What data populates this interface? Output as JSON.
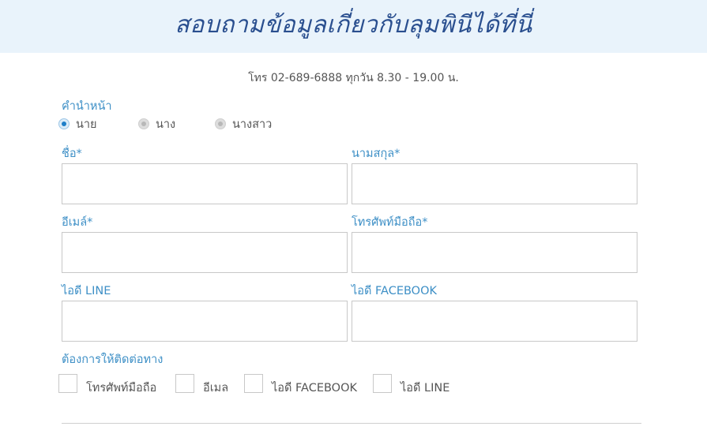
{
  "banner": {
    "title": "สอบถามข้อมูลเกี่ยวกับลุมพินีได้ที่นี่"
  },
  "contact": {
    "phone_line": "โทร 02-689-6888 ทุกวัน 8.30 - 19.00 น."
  },
  "form": {
    "title_label": "คำนำหน้า",
    "titles": [
      {
        "label": "นาย",
        "selected": true
      },
      {
        "label": "นาง",
        "selected": false
      },
      {
        "label": "นางสาว",
        "selected": false
      }
    ],
    "first_name_label": "ชื่อ*",
    "last_name_label": "นามสกุล*",
    "email_label": "อีเมล์*",
    "mobile_label": "โทรศัพท์มือถือ*",
    "line_label": "ไอดี LINE",
    "facebook_label": "ไอดี FACEBOOK",
    "contact_via_label": "ต้องการให้ติดต่อทาง",
    "contact_options": [
      "โทรศัพท์มือถือ",
      "อีเมล",
      "ไอดี FACEBOOK",
      "ไอดี LINE"
    ]
  },
  "colors": {
    "accent": "#3d8fc6",
    "banner_bg": "#e9f3fb",
    "title": "#2a4f8f"
  }
}
